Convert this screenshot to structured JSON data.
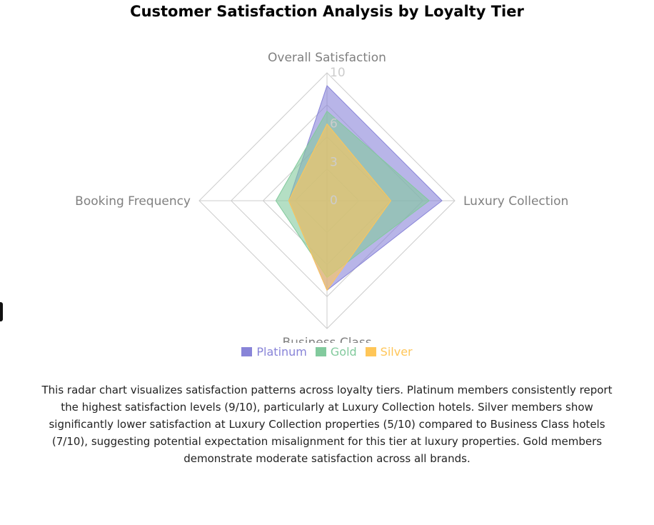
{
  "chart_data": {
    "type": "radar",
    "title": "Customer Satisfaction Analysis by Loyalty Tier",
    "axes": [
      "Overall Satisfaction",
      "Luxury Collection",
      "Business Class",
      "Booking Frequency"
    ],
    "radial_range": [
      0,
      10
    ],
    "ticks": [
      "0",
      "3",
      "6",
      "10"
    ],
    "series": [
      {
        "name": "Platinum",
        "values": [
          9,
          9,
          7,
          3
        ],
        "color": "#8884d8"
      },
      {
        "name": "Gold",
        "values": [
          7,
          8,
          6,
          4
        ],
        "color": "#82ca9d"
      },
      {
        "name": "Silver",
        "values": [
          6,
          5,
          7,
          3
        ],
        "color": "#ffc658"
      }
    ],
    "legend_position": "bottom",
    "grid": true
  },
  "description": "This radar chart visualizes satisfaction patterns across loyalty tiers. Platinum members consistently report the highest satisfaction levels (9/10), particularly at Luxury Collection hotels. Silver members show significantly lower satisfaction at Luxury Collection properties (5/10) compared to Business Class hotels (7/10), suggesting potential expectation misalignment for this tier at luxury properties. Gold members demonstrate moderate satisfaction across all brands."
}
